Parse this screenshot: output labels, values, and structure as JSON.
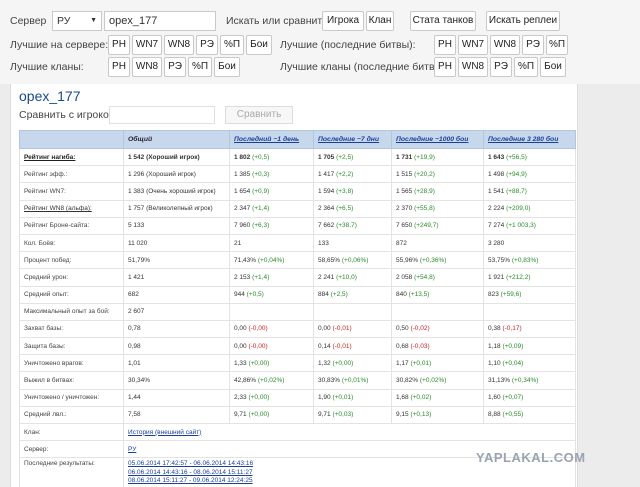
{
  "top": {
    "server_label": "Сервер",
    "server_value": "РУ",
    "search_value": "opex_177",
    "search_text": "Искать или сравнить",
    "btn_player": "Игрока",
    "btn_clan": "Клан",
    "btn_tank_stats": "Стата танков",
    "btn_replays": "Искать реплеи",
    "best_server_label": "Лучшие на сервере:",
    "best_recent_label": "Лучшие (последние битвы):",
    "best_clans_label": "Лучшие кланы:",
    "best_clans_recent_label": "Лучшие кланы (последние битвы):",
    "row1": [
      "РН",
      "WN7",
      "WN8",
      "РЭ",
      "%П",
      "Бои"
    ],
    "row1b": [
      "РН",
      "WN7",
      "WN8",
      "РЭ",
      "%П"
    ],
    "row2": [
      "РН",
      "WN8",
      "РЭ",
      "%П",
      "Бои"
    ],
    "row2b": [
      "РН",
      "WN8",
      "РЭ",
      "%П",
      "Бои"
    ]
  },
  "panel": {
    "player_name": "opex_177",
    "compare_label": "Сравнить с игроком",
    "compare_button": "Сравнить"
  },
  "table": {
    "headers": [
      "",
      "Общий",
      "Последний ~1 день",
      "Последние ~7 дни",
      "Последние ~1000 бои",
      "Последние 3 280 бои"
    ],
    "rows": [
      {
        "label": "Рейтинг нагиба:",
        "cells": [
          [
            "1 542 (Хороший игрок)",
            ""
          ],
          [
            "1 802",
            "(+0,5)"
          ],
          [
            "1 705",
            "(+2,5)"
          ],
          [
            "1 731",
            "(+19,9)"
          ],
          [
            "1 643",
            "(+56,5)"
          ]
        ]
      },
      {
        "label": "Рейтинг эфф.:",
        "cells": [
          [
            "1 296 (Хороший игрок)",
            ""
          ],
          [
            "1 385",
            "(+0,3)"
          ],
          [
            "1 417",
            "(+2,2)"
          ],
          [
            "1 515",
            "(+20,2)"
          ],
          [
            "1 498",
            "(+94,9)"
          ]
        ]
      },
      {
        "label": "Рейтинг WN7:",
        "cells": [
          [
            "1 383 (Очень хороший игрок)",
            ""
          ],
          [
            "1 654",
            "(+0,9)"
          ],
          [
            "1 594",
            "(+3,8)"
          ],
          [
            "1 565",
            "(+28,9)"
          ],
          [
            "1 541",
            "(+88,7)"
          ]
        ]
      },
      {
        "label": "Рейтинг WN8 (альфа):",
        "cells": [
          [
            "1 757 (Великолепный игрок)",
            ""
          ],
          [
            "2 347",
            "(+1,4)"
          ],
          [
            "2 364",
            "(+6,5)"
          ],
          [
            "2 370",
            "(+55,8)"
          ],
          [
            "2 224",
            "(+209,0)"
          ]
        ]
      },
      {
        "label": "Рейтинг Броне-сайта:",
        "cells": [
          [
            "5 133",
            ""
          ],
          [
            "7 960",
            "(+6,3)"
          ],
          [
            "7 662",
            "(+38,7)"
          ],
          [
            "7 650",
            "(+249,7)"
          ],
          [
            "7 274",
            "(+1 003,3)"
          ]
        ]
      },
      {
        "label": "Кол. Боёв:",
        "cells": [
          [
            "11 020",
            ""
          ],
          [
            "21",
            ""
          ],
          [
            "133",
            ""
          ],
          [
            "872",
            ""
          ],
          [
            "3 280",
            ""
          ]
        ]
      },
      {
        "label": "Процент побед:",
        "cells": [
          [
            "51,79%",
            ""
          ],
          [
            "71,43%",
            "(+0,04%)"
          ],
          [
            "58,65%",
            "(+0,06%)"
          ],
          [
            "55,96%",
            "(+0,36%)"
          ],
          [
            "53,75%",
            "(+0,83%)"
          ]
        ]
      },
      {
        "label": "Средний урон:",
        "cells": [
          [
            "1 421",
            ""
          ],
          [
            "2 153",
            "(+1,4)"
          ],
          [
            "2 241",
            "(+10,0)"
          ],
          [
            "2 058",
            "(+54,8)"
          ],
          [
            "1 921",
            "(+212,2)"
          ]
        ]
      },
      {
        "label": "Средний опыт:",
        "cells": [
          [
            "682",
            ""
          ],
          [
            "944",
            "(+0,5)"
          ],
          [
            "884",
            "(+2,5)"
          ],
          [
            "840",
            "(+13,5)"
          ],
          [
            "823",
            "(+59,6)"
          ]
        ]
      },
      {
        "label": "Максимальный опыт за бой:",
        "cells": [
          [
            "2 607",
            ""
          ],
          [
            "",
            ""
          ],
          [
            "",
            ""
          ],
          [
            "",
            ""
          ],
          [
            "",
            ""
          ]
        ]
      },
      {
        "label": "Захват базы:",
        "cells": [
          [
            "0,78",
            ""
          ],
          [
            "0,00",
            "(-0,00)"
          ],
          [
            "0,00",
            "(-0,01)"
          ],
          [
            "0,50",
            "(-0,02)"
          ],
          [
            "0,38",
            "(-0,17)"
          ]
        ]
      },
      {
        "label": "Защита базы:",
        "cells": [
          [
            "0,98",
            ""
          ],
          [
            "0,00",
            "(-0,00)"
          ],
          [
            "0,14",
            "(-0,01)"
          ],
          [
            "0,68",
            "(-0,03)"
          ],
          [
            "1,18",
            "(+0,09)"
          ]
        ]
      },
      {
        "label": "Уничтожено врагов:",
        "cells": [
          [
            "1,01",
            ""
          ],
          [
            "1,33",
            "(+0,00)"
          ],
          [
            "1,32",
            "(+0,00)"
          ],
          [
            "1,17",
            "(+0,01)"
          ],
          [
            "1,10",
            "(+0,04)"
          ]
        ]
      },
      {
        "label": "Выжил в битвах:",
        "cells": [
          [
            "30,34%",
            ""
          ],
          [
            "42,86%",
            "(+0,02%)"
          ],
          [
            "30,83%",
            "(+0,01%)"
          ],
          [
            "30,82%",
            "(+0,02%)"
          ],
          [
            "31,13%",
            "(+0,34%)"
          ]
        ]
      },
      {
        "label": "Уничтожено / уничтожен:",
        "cells": [
          [
            "1,44",
            ""
          ],
          [
            "2,33",
            "(+0,00)"
          ],
          [
            "1,90",
            "(+0,01)"
          ],
          [
            "1,68",
            "(+0,02)"
          ],
          [
            "1,60",
            "(+0,07)"
          ]
        ]
      },
      {
        "label": "Средний лвл.:",
        "cells": [
          [
            "7,58",
            ""
          ],
          [
            "9,71",
            "(+0,00)"
          ],
          [
            "9,71",
            "(+0,03)"
          ],
          [
            "9,15",
            "(+0,13)"
          ],
          [
            "8,88",
            "(+0,55)"
          ]
        ]
      }
    ],
    "clan_label": "Клан:",
    "clan_value": "История (внешний сайт)",
    "server_label": "Сервер:",
    "server_value": "РУ",
    "results_label": "Последние результаты:",
    "results": [
      "05.06.2014 17:42:57 - 06.06.2014 14:43:16",
      "06.06.2014 14:43:16 - 08.06.2014 15:11:27",
      "08.06.2014 15:11:27 - 09.06.2014 12:24:25"
    ]
  },
  "watermark": "YAPLAKAL.COM",
  "colors": {
    "positive": "#2a8a2a",
    "negative": "#cc2222",
    "header_bg": "#c7d8ec",
    "link": "#1a3e9a"
  }
}
